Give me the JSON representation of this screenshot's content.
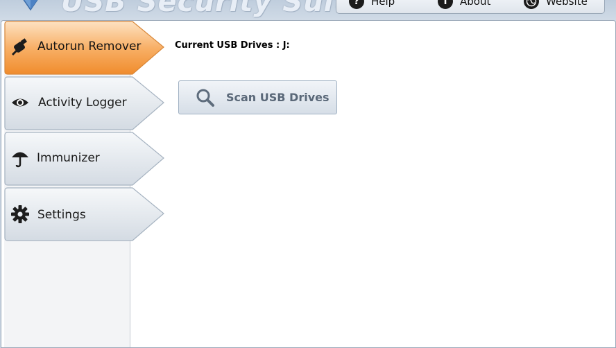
{
  "app": {
    "title": "USB Security Suite",
    "accent_color": "#f59b3a"
  },
  "topbar": {
    "help_label": "Help",
    "help_icon": "question-icon",
    "about_label": "About",
    "about_icon": "info-icon",
    "website_label": "Website",
    "website_icon": "globe-icon"
  },
  "sidebar": {
    "items": [
      {
        "label": "Autorun Remover",
        "icon": "usb-plug-icon",
        "active": true
      },
      {
        "label": "Activity Logger",
        "icon": "eye-icon",
        "active": false
      },
      {
        "label": "Immunizer",
        "icon": "umbrella-icon",
        "active": false
      },
      {
        "label": "Settings",
        "icon": "gear-icon",
        "active": false
      }
    ]
  },
  "main": {
    "current_drives_label": "Current USB Drives :  J:",
    "scan_button_label": "Scan USB Drives",
    "scan_button_icon": "magnifier-icon"
  }
}
